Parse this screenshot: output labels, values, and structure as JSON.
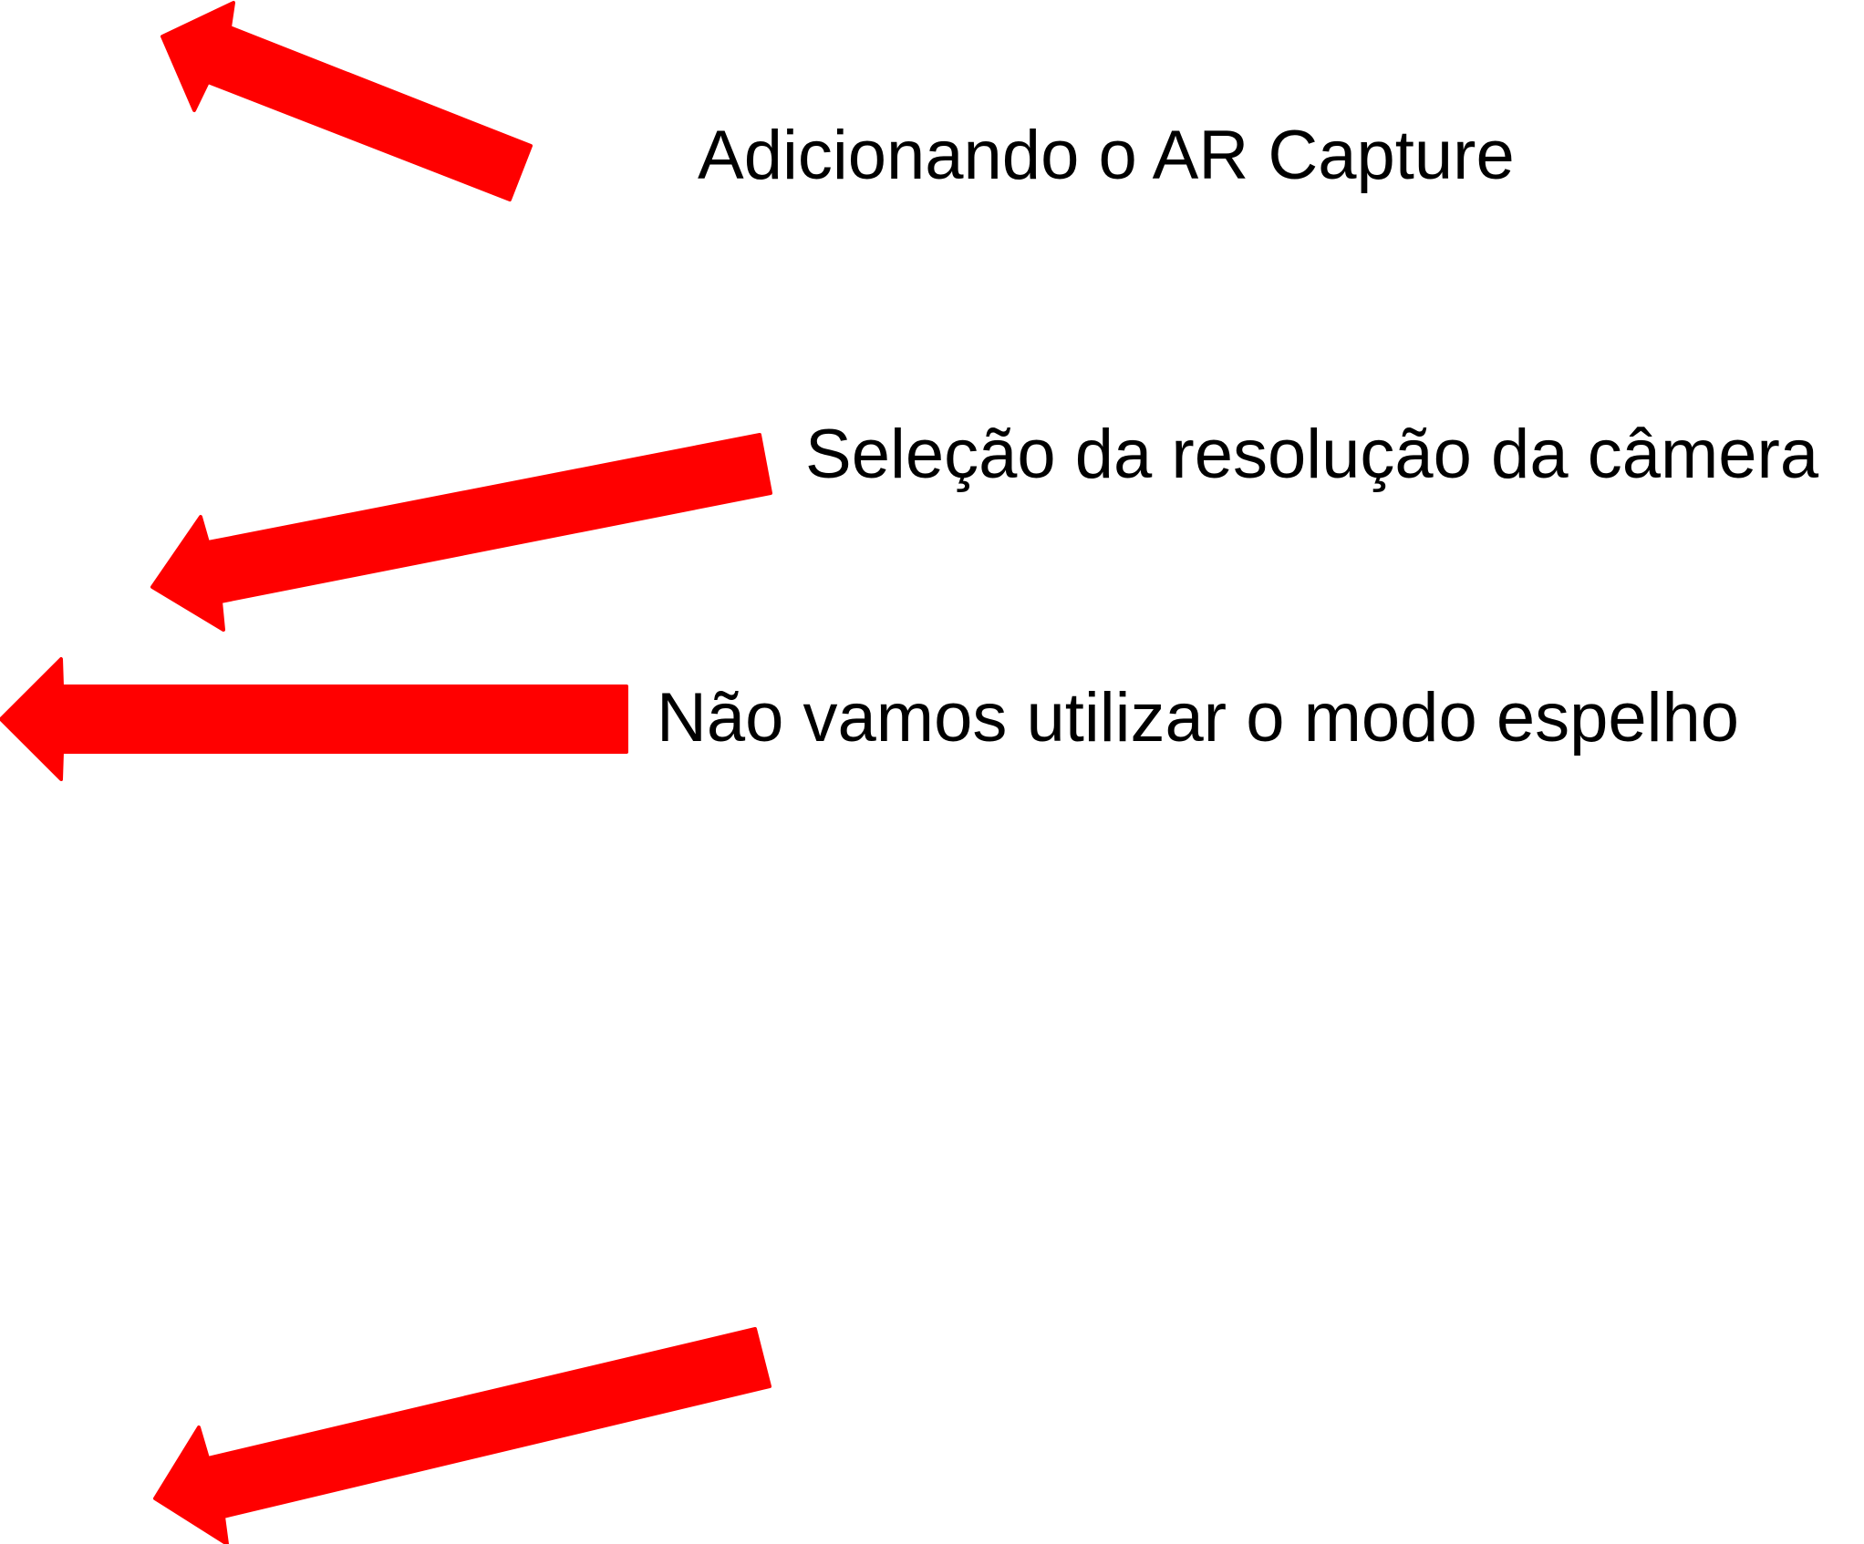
{
  "annotations": {
    "arrow_color": "#ff0000",
    "text_color": "#000000",
    "captions": [
      "Adicionando o AR Capture",
      "Seleção da resolução da câmera",
      "Não vamos utilizar o modo espelho"
    ]
  }
}
